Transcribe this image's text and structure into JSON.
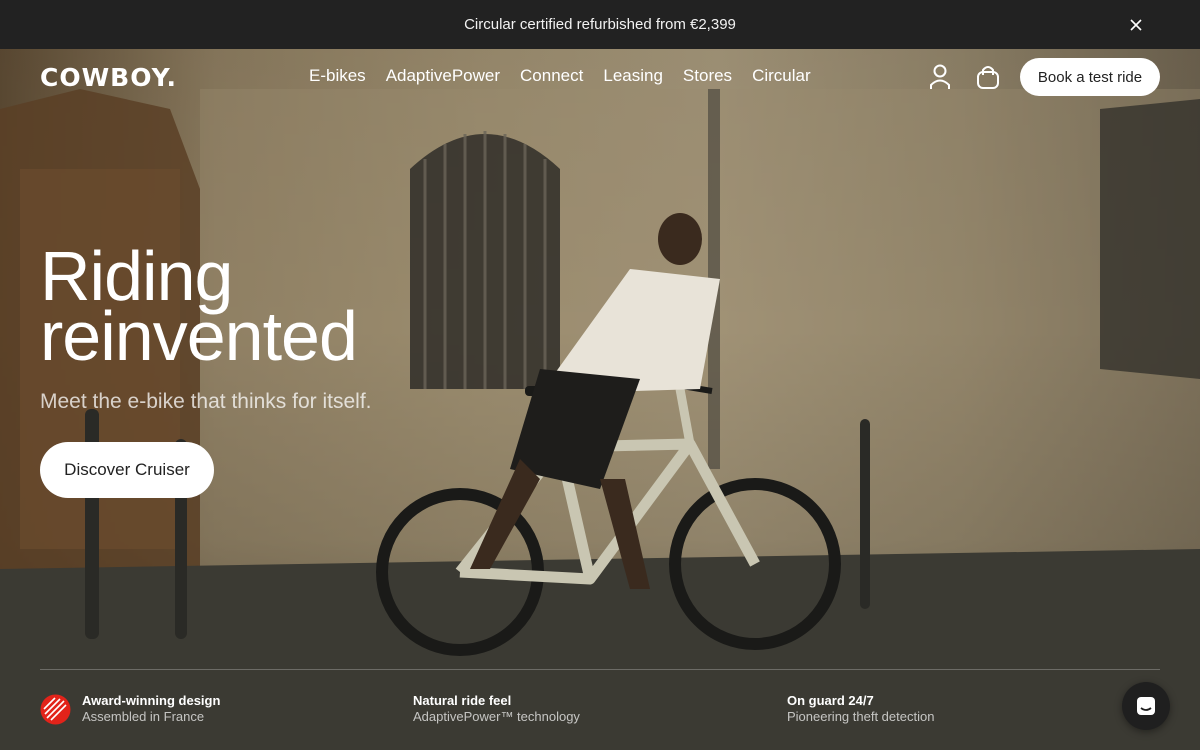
{
  "announcement": {
    "text": "Circular certified refurbished from €2,399",
    "close_icon": "close-icon"
  },
  "header": {
    "logo": "COWBOY.",
    "nav": [
      "E-bikes",
      "AdaptivePower",
      "Connect",
      "Leasing",
      "Stores",
      "Circular"
    ],
    "account_icon": "user-icon",
    "cart_icon": "bag-icon",
    "cta_label": "Book a test ride"
  },
  "hero": {
    "headline_line1": "Riding",
    "headline_line2": "reinvented",
    "subline": "Meet the e-bike that thinks for itself.",
    "cta_label": "Discover Cruiser"
  },
  "features": [
    {
      "title": "Award-winning design",
      "subtitle": "Assembled in France",
      "icon": "red-dot-award-icon"
    },
    {
      "title": "Natural ride feel",
      "subtitle": "AdaptivePower™ technology"
    },
    {
      "title": "On guard 24/7",
      "subtitle": "Pioneering theft detection"
    }
  ],
  "chat": {
    "icon": "chat-icon"
  },
  "colors": {
    "announcement_bg": "#222222",
    "award_red": "#e2231a",
    "button_bg": "#ffffff"
  }
}
